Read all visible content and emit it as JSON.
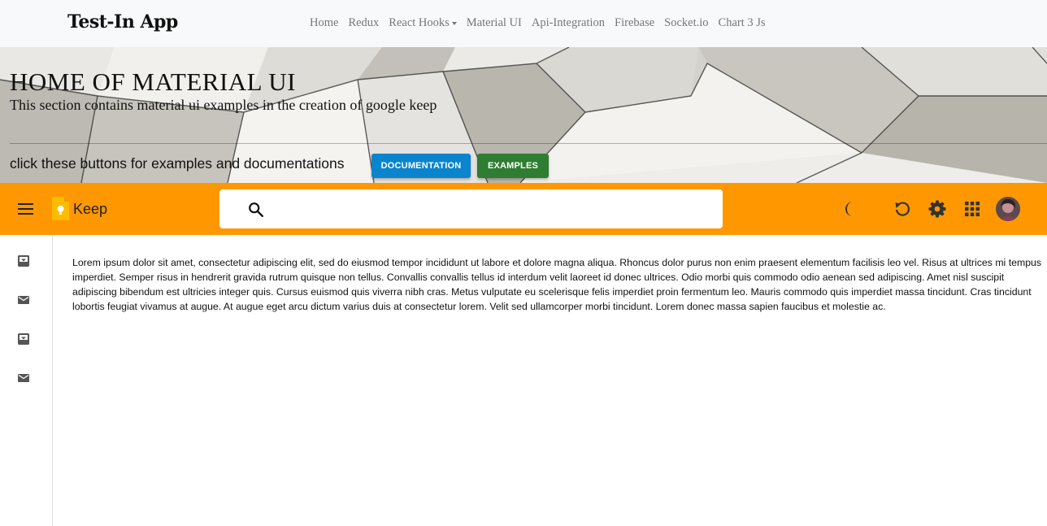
{
  "navbar": {
    "brand": "Test-In App",
    "links": [
      "Home",
      "Redux",
      "React Hooks",
      "Material UI",
      "Api-Integration",
      "Firebase",
      "Socket.io",
      "Chart 3 Js"
    ]
  },
  "hero": {
    "title": "HOME OF MATERIAL UI",
    "subtitle": "This section contains material ui examples in the creation of google keep",
    "cta_text": "click these buttons for examples and documentations",
    "documentation_button": "DOCUMENTATION",
    "examples_button": "EXAMPLES"
  },
  "appbar": {
    "app_name": "Keep",
    "search_placeholder": "",
    "icons": [
      "menu-icon",
      "keep-logo-icon",
      "search-icon",
      "dark-mode-icon",
      "refresh-icon",
      "settings-icon",
      "apps-grid-icon",
      "avatar"
    ]
  },
  "sidebar": {
    "icons": [
      "inbox-icon",
      "mail-icon",
      "inbox-icon",
      "mail-icon"
    ]
  },
  "main": {
    "body_text": "Lorem ipsum dolor sit amet, consectetur adipiscing elit, sed do eiusmod tempor incididunt ut labore et dolore magna aliqua. Rhoncus dolor purus non enim praesent elementum facilisis leo vel. Risus at ultrices mi tempus imperdiet. Semper risus in hendrerit gravida rutrum quisque non tellus. Convallis convallis tellus id interdum velit laoreet id donec ultrices. Odio morbi quis commodo odio aenean sed adipiscing. Amet nisl suscipit adipiscing bibendum est ultricies integer quis. Cursus euismod quis viverra nibh cras. Metus vulputate eu scelerisque felis imperdiet proin fermentum leo. Mauris commodo quis imperdiet massa tincidunt. Cras tincidunt lobortis feugiat vivamus at augue. At augue eget arcu dictum varius duis at consectetur lorem. Velit sed ullamcorper morbi tincidunt. Lorem donec massa sapien faucibus et molestie ac."
  },
  "colors": {
    "appbar": "#ff9800",
    "documentation_button": "#0a84cd",
    "examples_button": "#2e7d32",
    "navbar_bg": "#f8f9fa"
  }
}
